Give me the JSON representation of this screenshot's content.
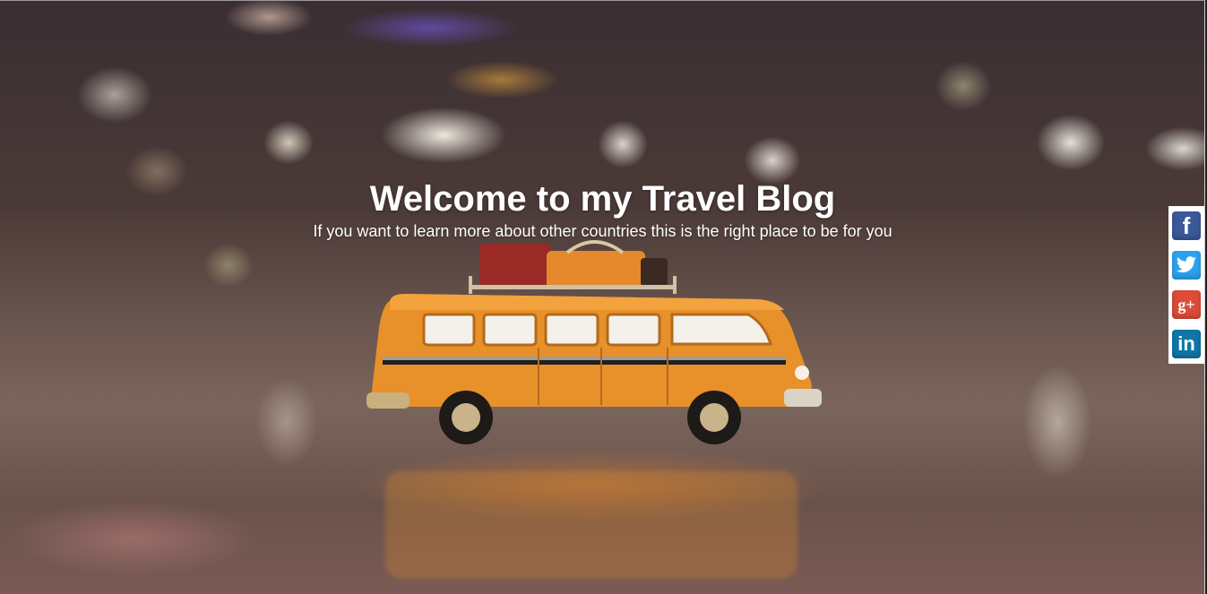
{
  "hero": {
    "title": "Welcome to my Travel Blog",
    "subtitle": "If you want to learn more about other countries this is the right place to be for you",
    "background_image": "blurred city lights with a toy orange bus on reflective floor"
  },
  "social": {
    "items": [
      {
        "name": "facebook",
        "icon": "facebook-icon",
        "glyph": "f",
        "color": "#3b5998"
      },
      {
        "name": "twitter",
        "icon": "twitter-icon",
        "glyph": "",
        "color": "#2aa3ef"
      },
      {
        "name": "google-plus",
        "icon": "google-plus-icon",
        "glyph": "g+",
        "color": "#dd4b39"
      },
      {
        "name": "linkedin",
        "icon": "linkedin-icon",
        "glyph": "in",
        "color": "#0e76a8"
      }
    ]
  },
  "colors": {
    "bus_body": "#e8902a",
    "text": "#ffffff"
  }
}
